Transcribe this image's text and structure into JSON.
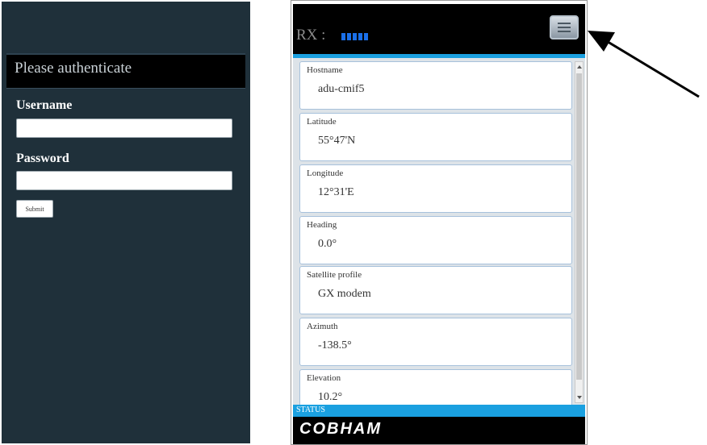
{
  "login": {
    "title": "Please authenticate",
    "username_label": "Username",
    "username_value": "",
    "password_label": "Password",
    "password_value": "",
    "submit_label": "Submit"
  },
  "device": {
    "rx_label": "RX :",
    "signal_bars": 5,
    "signal_color": "#1a6fe8",
    "menu_icon": "menu-icon",
    "fields": [
      {
        "label": "Hostname",
        "value": "adu-cmif5"
      },
      {
        "label": "Latitude",
        "value": "55°47'N"
      },
      {
        "label": "Longitude",
        "value": "12°31'E"
      },
      {
        "label": "Heading",
        "value": "0.0°"
      },
      {
        "label": "Satellite profile",
        "value": "GX modem"
      },
      {
        "label": "Azimuth",
        "value": "-138.5°"
      },
      {
        "label": "Elevation",
        "value": "10.2°"
      }
    ],
    "status_label": "STATUS",
    "brand": "COBHAM",
    "accent_color": "#1aa0e0"
  },
  "annotation": {
    "arrow_icon": "callout-arrow-icon"
  }
}
